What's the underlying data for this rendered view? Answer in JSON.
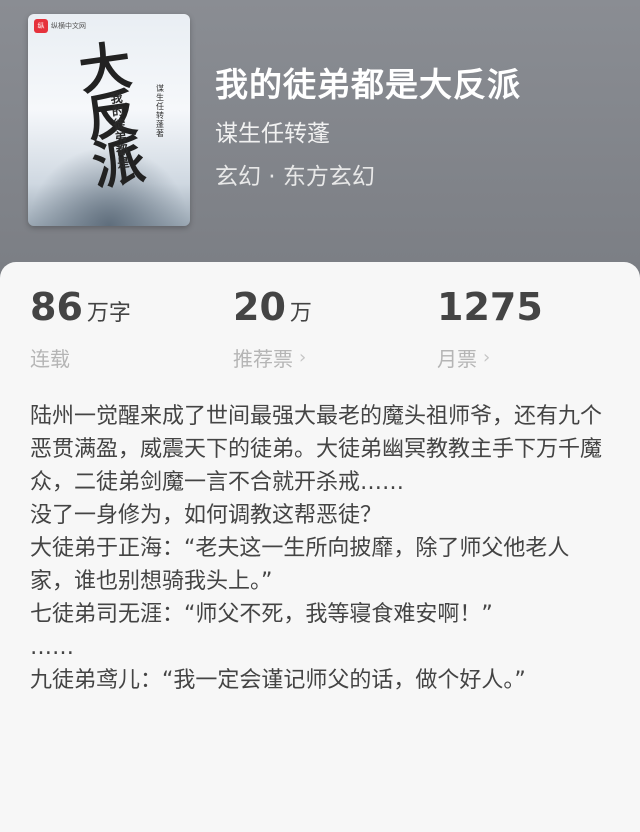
{
  "book": {
    "cover": {
      "publisher": "纵横中文网",
      "publisher_mark": "纵",
      "title_art": "大反派",
      "subtitle_art": "我的徒弟都是",
      "author_art": "谋生任转蓬 著"
    },
    "title": "我的徒弟都是大反派",
    "author": "谋生任转蓬",
    "genre": "玄幻 · 东方玄幻"
  },
  "stats": [
    {
      "value": "86",
      "unit": "万字",
      "label": "连载",
      "link": false
    },
    {
      "value": "20",
      "unit": "万",
      "label": "推荐票",
      "link": true
    },
    {
      "value": "1275",
      "unit": "",
      "label": "月票",
      "link": true
    }
  ],
  "chevron": "›",
  "description": [
    "陆州一觉醒来成了世间最强大最老的魔头祖师爷，还有九个恶贯满盈，威震天下的徒弟。大徒弟幽冥教教主手下万千魔众，二徒弟剑魔一言不合就开杀戒……",
    "没了一身修为，如何调教这帮恶徒？",
    "大徒弟于正海：“老夫这一生所向披靡，除了师父他老人家，谁也别想骑我头上。”",
    "七徒弟司无涯：“师父不死，我等寝食难安啊！”",
    "……",
    "九徒弟鸢儿：“我一定会谨记师父的话，做个好人。”"
  ]
}
